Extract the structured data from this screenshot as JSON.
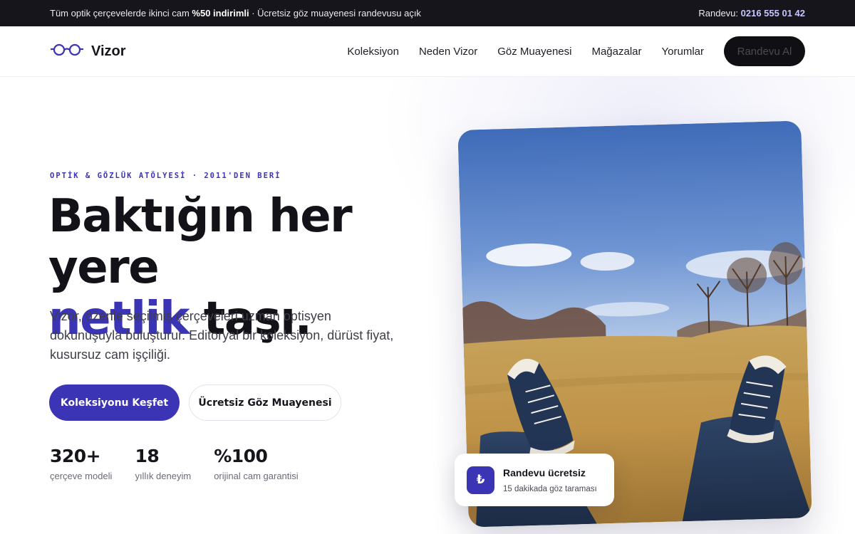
{
  "promo": {
    "text_before": "Tüm optik çerçevelerde ikinci cam ",
    "highlight": "%50 indirimli",
    "text_after": " · Ücretsiz göz muayenesi randevusu açık",
    "phone_label": "Randevu: ",
    "phone": "0216 555 01 42"
  },
  "header": {
    "brand": "Vizor",
    "logo_icon": "glasses-icon",
    "nav": [
      "Koleksiyon",
      "Neden Vizor",
      "Göz Muayenesi",
      "Mağazalar",
      "Yorumlar"
    ],
    "cta": "Randevu Al"
  },
  "hero": {
    "eyebrow": "OPTİK & GÖZLÜK ATÖLYESİ · 2011'DEN BERİ",
    "headline_1": "Baktığın her yere",
    "headline_accent": "netlik",
    "headline_2": " taşı.",
    "lead": "Vizor, özenle seçilmiş çerçeveleri uzman optisyen dokunuşuyla buluşturur. Editoryal bir koleksiyon, dürüst fiyat, kusursuz cam işçiliği.",
    "primary_cta": "Koleksiyonu Keşfet",
    "secondary_cta": "Ücretsiz Göz Muayenesi",
    "stats": [
      {
        "value": "320+",
        "label": "çerçeve modeli"
      },
      {
        "value": "18",
        "label": "yıllık deneyim"
      },
      {
        "value": "%100",
        "label": "orijinal cam garantisi"
      }
    ]
  },
  "badge": {
    "icon_symbol": "₺",
    "icon_name": "lira-icon",
    "title": "Randevu ücretsiz",
    "subtitle": "15 dakikada göz taraması"
  },
  "colors": {
    "accent": "#3b34b5",
    "dark": "#15151b",
    "text": "#15151c"
  }
}
